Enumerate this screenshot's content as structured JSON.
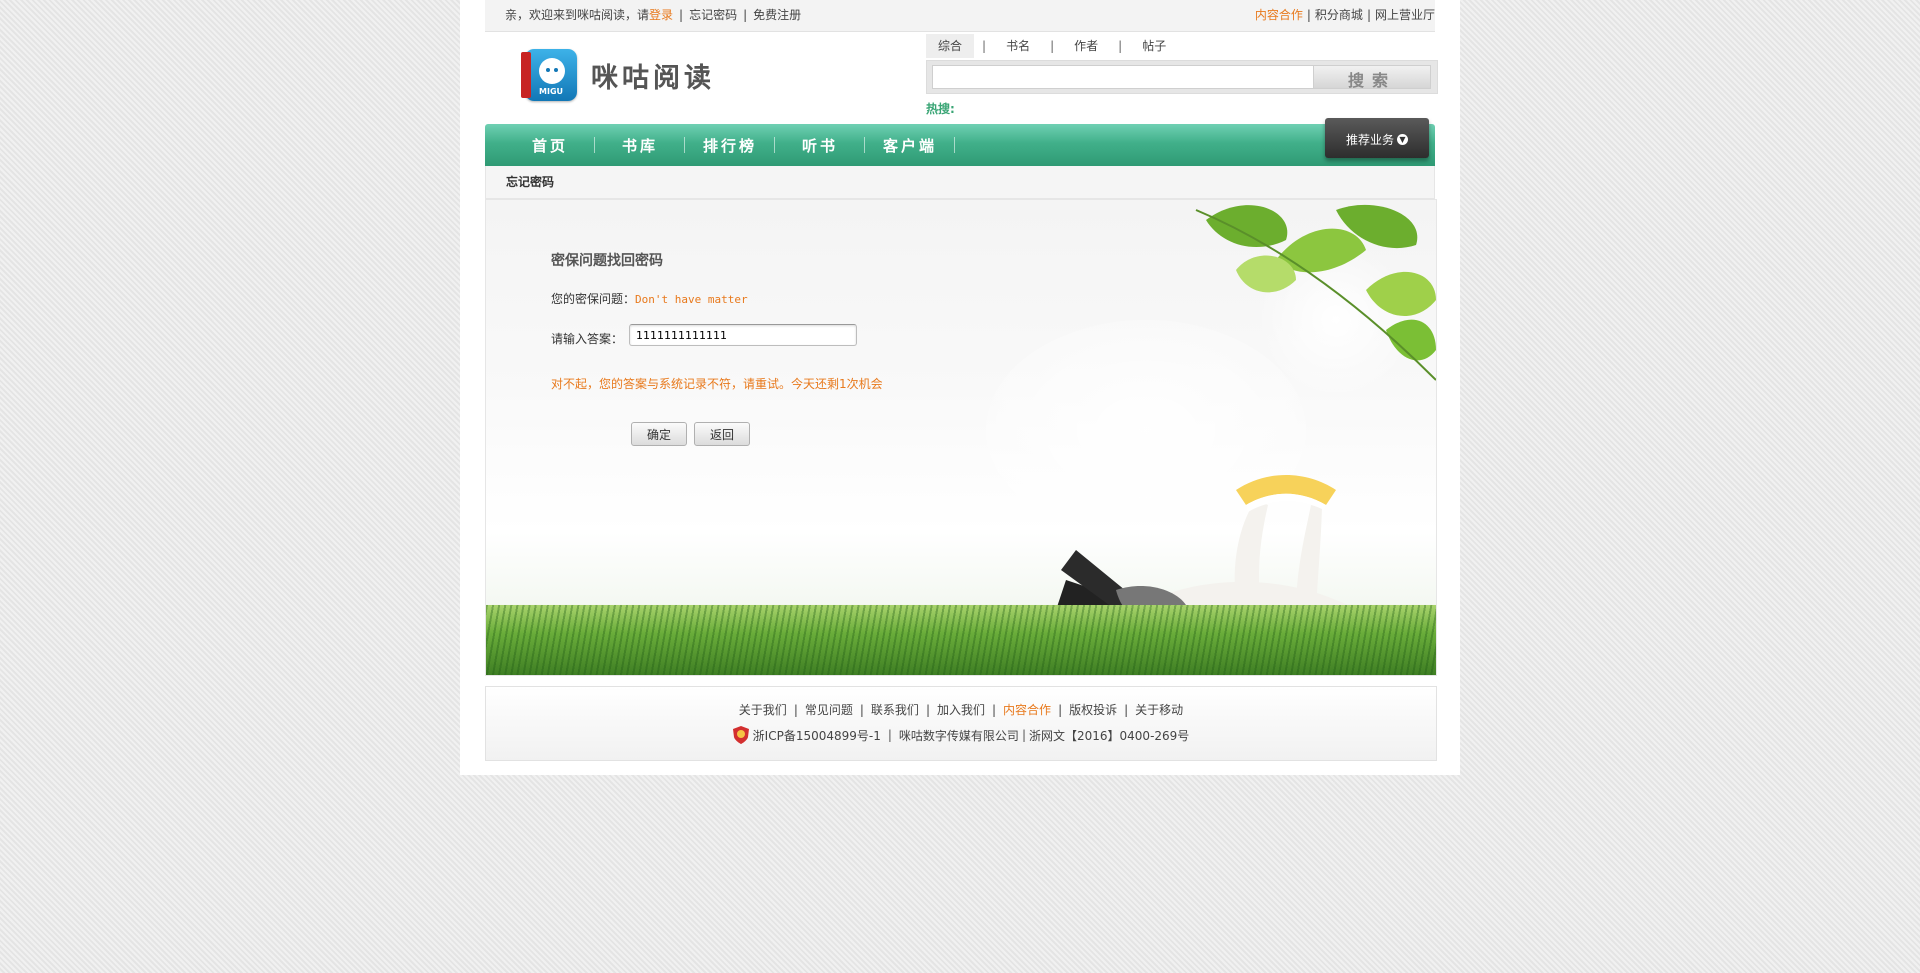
{
  "topbar": {
    "greeting": "亲，欢迎来到咪咕阅读，请",
    "login": "登录",
    "forgot": "忘记密码",
    "register": "免费注册",
    "right_links": [
      "内容合作",
      "积分商城",
      "网上营业厅"
    ]
  },
  "logo": {
    "name": "咪咕阅读",
    "badge_text": "MIGU"
  },
  "search": {
    "tabs": [
      "综合",
      "书名",
      "作者",
      "帖子"
    ],
    "active_tab": "综合",
    "placeholder": "",
    "button": "搜索",
    "hot_label": "热搜:"
  },
  "nav": {
    "items": [
      "首页",
      "书库",
      "排行榜",
      "听书",
      "客户端"
    ],
    "recommend": "推荐业务"
  },
  "breadcrumb": "忘记密码",
  "form": {
    "title": "密保问题找回密码",
    "question_label": "您的密保问题：",
    "question_value": "Don't have matter",
    "answer_label": "请输入答案：",
    "answer_value": "1111111111111",
    "error": "对不起，您的答案与系统记录不符，请重试。今天还剩1次机会",
    "confirm": "确定",
    "back": "返回"
  },
  "footer": {
    "links": [
      "关于我们",
      "常见问题",
      "联系我们",
      "加入我们",
      "内容合作",
      "版权投诉",
      "关于移动"
    ],
    "icp": "浙ICP备15004899号-1",
    "company": "咪咕数字传媒有限公司",
    "license": "浙网文【2016】0400-269号"
  },
  "colors": {
    "accent_orange": "#e8791c",
    "nav_green": "#41b08a",
    "hot_green": "#3aa575"
  }
}
